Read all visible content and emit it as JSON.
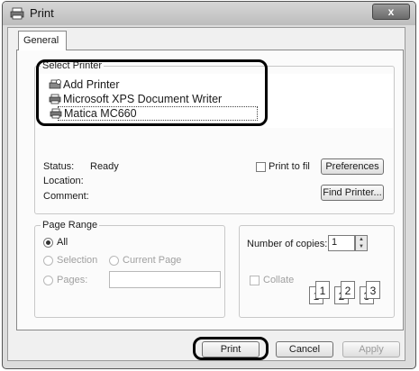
{
  "window": {
    "title": "Print",
    "close_glyph": "x"
  },
  "tabs": [
    {
      "label": "General"
    }
  ],
  "select_printer": {
    "legend": "Select Printer",
    "printers": [
      "Add Printer",
      "Microsoft XPS Document Writer",
      "Matica MC660"
    ],
    "selected_index": 2
  },
  "status": {
    "status_label": "Status:",
    "status_value": "Ready",
    "location_label": "Location:",
    "location_value": "",
    "comment_label": "Comment:",
    "comment_value": ""
  },
  "print_to_file": {
    "label": "Print to file",
    "checked": false
  },
  "buttons": {
    "preferences": "Preferences",
    "find_printer": "Find Printer...",
    "print": "Print",
    "cancel": "Cancel",
    "apply": "Apply"
  },
  "page_range": {
    "legend": "Page Range",
    "all": "All",
    "selection": "Selection",
    "current_page": "Current Page",
    "pages": "Pages:",
    "pages_value": "",
    "selected": "All"
  },
  "copies": {
    "label": "Number of copies:",
    "value": "1",
    "collate_label": "Collate",
    "collate_checked": false,
    "collate_pages": [
      "1",
      "1",
      "2",
      "2",
      "3",
      "3"
    ]
  },
  "icons": {
    "title": "printer-icon",
    "add_printer": "add-printer-icon",
    "printer": "printer-icon",
    "spinner_up": "▲",
    "spinner_down": "▼"
  },
  "colors": {
    "highlight_outline": "#000000",
    "dialog_bg": "#f0f0f0"
  }
}
